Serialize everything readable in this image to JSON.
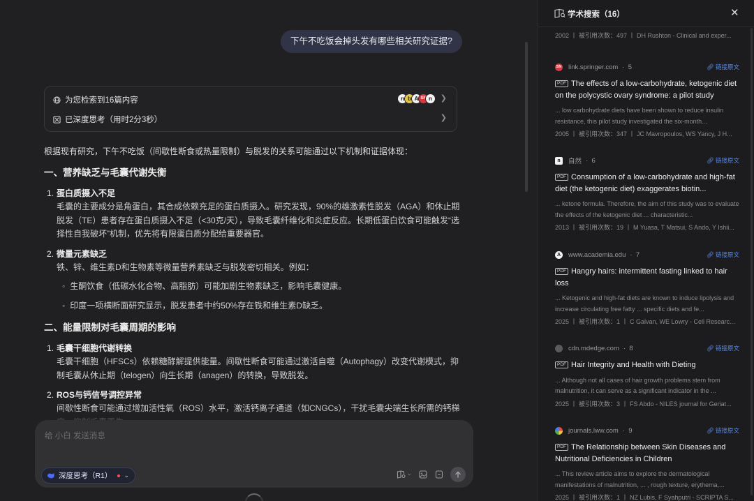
{
  "chat": {
    "user_message": "下午不吃饭会掉头发有哪些相关研究证据?",
    "search_card": {
      "found_label": "为您检索到16篇内容",
      "thinking_label": "已深度思考（用时2分3秒）"
    },
    "answer": {
      "intro": "根据现有研究，下午不吃饭（间歇性断食或热量限制）与脱发的关系可能通过以下机制和证据体现：",
      "section1_heading": "一、营养缺乏与毛囊代谢失衡",
      "s1_item1_title": "蛋白质摄入不足",
      "s1_item1_body": "毛囊的主要成分是角蛋白，其合成依赖充足的蛋白质摄入。研究发现，90%的雄激素性脱发（AGA）和休止期脱发（TE）患者存在蛋白质摄入不足（<30克/天），导致毛囊纤维化和炎症反应。长期低蛋白饮食可能触发“选择性自我破坏”机制，优先将有限蛋白质分配给重要器官。",
      "s1_item2_title": "微量元素缺乏",
      "s1_item2_body": "铁、锌、维生素D和生物素等微量营养素缺乏与脱发密切相关。例如：",
      "s1_item2_sub1": "生酮饮食（低碳水化合物、高脂肪）可能加剧生物素缺乏，影响毛囊健康。",
      "s1_item2_sub2": "印度一项横断面研究显示，脱发患者中约50%存在铁和维生素D缺乏。",
      "section2_heading": "二、能量限制对毛囊周期的影响",
      "s2_item1_title": "毛囊干细胞代谢转换",
      "s2_item1_body": "毛囊干细胞（HFSCs）依赖糖酵解提供能量。间歇性断食可能通过激活自噬（Autophagy）改变代谢模式，抑制毛囊从休止期（telogen）向生长期（anagen）的转换，导致脱发。",
      "s2_item2_title": "ROS与钙信号调控异常",
      "s2_item2_body": "间歇性断食可能通过增加活性氧（ROS）水平，激活钙离子通道（如CNGCs），干扰毛囊尖端生长所需的钙梯度，抑制毛囊再生。"
    },
    "composer": {
      "placeholder": "给 小白 发送消息",
      "deep_think_label": "深度思考（R1）"
    }
  },
  "panel": {
    "title": "学术搜索（16）",
    "link_label": "链接原文",
    "top_partial_meta": "2002 丨 被引用次数：497 丨 DH Rushton - Clinical and exper...",
    "results": [
      {
        "source": "link.springer.com",
        "rank": "5",
        "title": "The effects of a low-carbohydrate, ketogenic diet on the polycystic ovary syndrome: a pilot study",
        "snippet": "... low carbohydrate diets have been shown to reduce insulin resistance, this pilot study investigated the six-month...",
        "meta": "2005 丨 被引用次数：347 丨 JC Mavropoulos, WS Yancy, J H..."
      },
      {
        "source": "自然",
        "rank": "6",
        "title": "Consumption of a low-carbohydrate and high-fat diet (the ketogenic diet) exaggerates biotin...",
        "snippet": "... ketone formula. Therefore, the aim of this study was to evaluate the effects of the ketogenic diet ... characteristic...",
        "meta": "2013 丨 被引用次数：19 丨 M Yuasa, T Matsui, S Ando, Y Ishii..."
      },
      {
        "source": "www.academia.edu",
        "rank": "7",
        "title": "Hangry hairs: intermittent fasting linked to hair loss",
        "snippet": "... Ketogenic and high-fat diets are known to induce lipolysis and increase circulating free fatty ... specific diets and fe...",
        "meta": "2025 丨 被引用次数：1 丨 C Galvan, WE Lowry - Cell Researc..."
      },
      {
        "source": "cdn.mdedge.com",
        "rank": "8",
        "title": "Hair Integrity and Health with Dieting",
        "snippet": "... Although not all cases of hair growth problems stem from malnutrition, it can serve as a significant indicator in the ...",
        "meta": "2025 丨 被引用次数：3 丨 FS Abdo - NILES journal for Geriat..."
      },
      {
        "source": "journals.lww.com",
        "rank": "9",
        "title": "The Relationship between Skin Diseases and Nutritional Deficiencies in Children",
        "snippet": "... This review article aims to explore the dermatological manifestations of malnutrition, ... , rough texture, erythema,...",
        "meta": "2025 丨 被引用次数：1 丨 NZ Lubis, F Syahputri - SCRIPTA S..."
      }
    ]
  },
  "colors": {
    "background": "#202022",
    "panel": "#1c1c1e",
    "accent_link": "#5b8def",
    "user_bubble": "#313446"
  },
  "icons": [
    "globe-icon",
    "thinking-icon",
    "chevron-right-icon",
    "whale-icon",
    "chevron-down-icon",
    "search-book-icon",
    "attach-icon",
    "image-icon",
    "send-arrow-icon",
    "close-icon",
    "link-icon"
  ]
}
